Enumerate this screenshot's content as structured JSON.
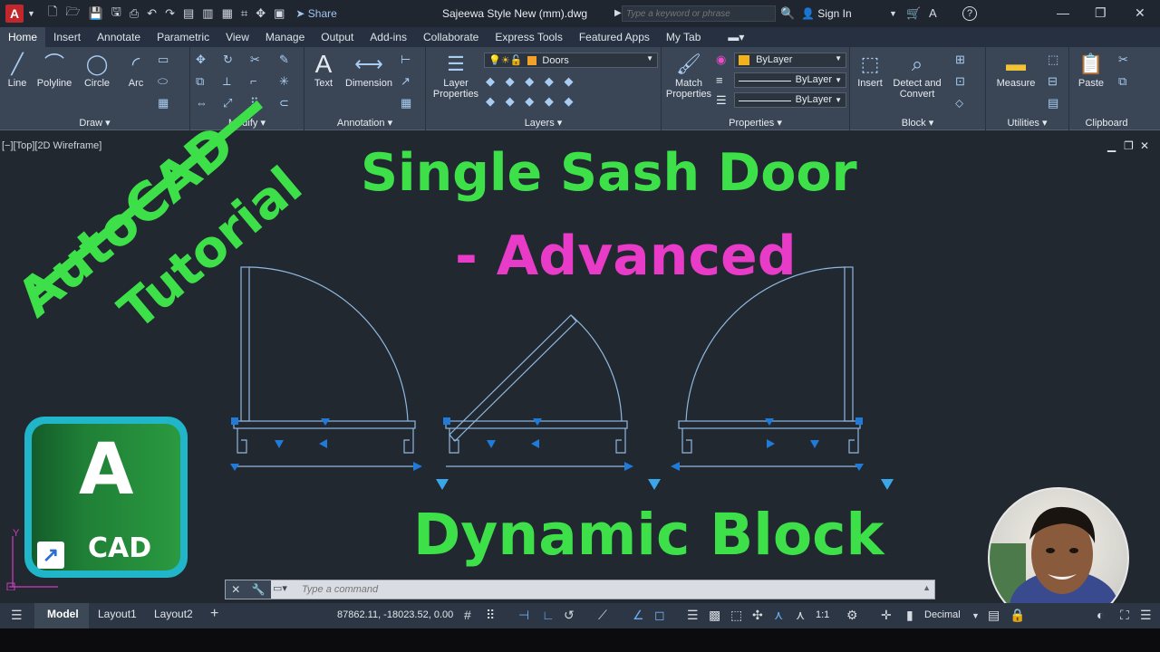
{
  "titlebar": {
    "app_letter": "A",
    "share_label": "Share",
    "document_title": "Sajeewa Style New (mm).dwg",
    "search_placeholder": "Type a keyword or phrase",
    "signin_label": "Sign In",
    "help_icon": "?"
  },
  "ribbon_tabs": [
    "Home",
    "Insert",
    "Annotate",
    "Parametric",
    "View",
    "Manage",
    "Output",
    "Add-ins",
    "Collaborate",
    "Express Tools",
    "Featured Apps",
    "My Tab"
  ],
  "ribbon": {
    "draw": {
      "label": "Draw",
      "tools": [
        "Line",
        "Polyline",
        "Circle",
        "Arc"
      ]
    },
    "modify": {
      "label": "Modify"
    },
    "annotation": {
      "label": "Annotation",
      "tools": [
        "Text",
        "Dimension"
      ]
    },
    "layers": {
      "label": "Layers",
      "tool": "Layer Properties",
      "current_layer": "Doors"
    },
    "properties": {
      "label": "Properties",
      "tool": "Match Properties",
      "color": "ByLayer",
      "linetype": "ByLayer",
      "lineweight": "ByLayer"
    },
    "block": {
      "label": "Block",
      "tools": [
        "Insert",
        "Detect and Convert"
      ]
    },
    "utilities": {
      "label": "Utilities",
      "tool": "Measure"
    },
    "clipboard": {
      "label": "Clipboard",
      "tool": "Paste"
    }
  },
  "viewport": {
    "label": "[−][Top][2D Wireframe]",
    "banner_line1": "AutoCAD",
    "banner_line2": "Tutorial",
    "heading": "Single Sash Door",
    "subheading": "- Advanced",
    "footer_heading": "Dynamic Block",
    "logo_letter": "A",
    "logo_word": "CAD",
    "ucs_y": "Y"
  },
  "commandline": {
    "placeholder": "Type a command"
  },
  "statusbar": {
    "tabs": [
      "Model",
      "Layout1",
      "Layout2"
    ],
    "coordinates": "87862.11, -18023.52, 0.00",
    "scale": "1:1",
    "units": "Decimal"
  },
  "colors": {
    "banner_green": "#3ee04a",
    "heading_green": "#3ee04a",
    "subheading_magenta": "#e83cc8",
    "door_line": "#8fb8e0",
    "grip_blue": "#1f7ad8"
  }
}
